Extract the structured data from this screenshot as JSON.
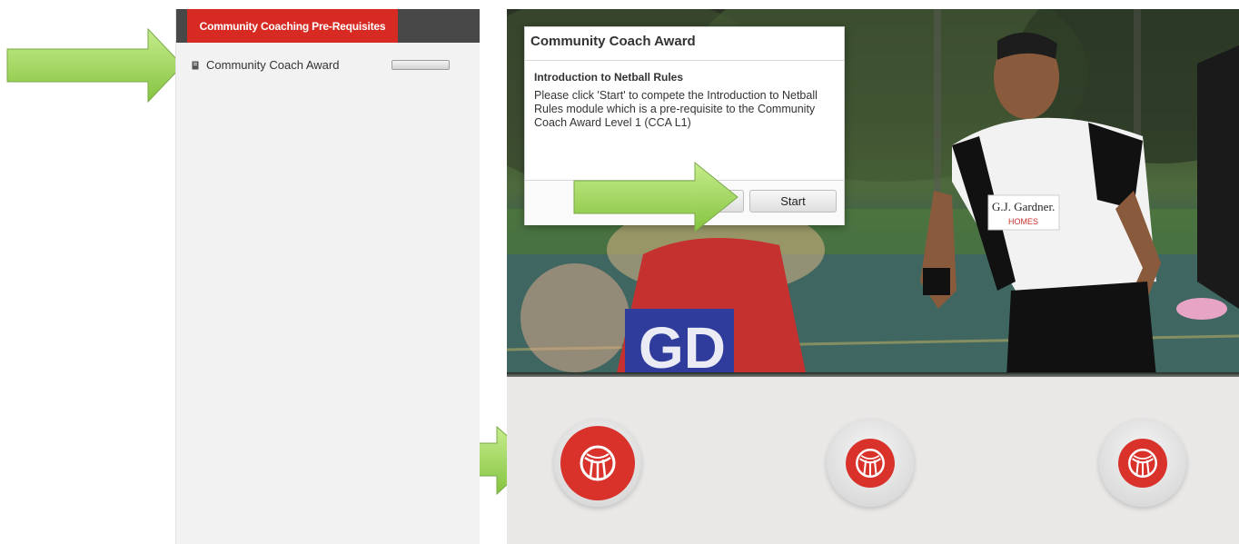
{
  "sidebar": {
    "tab_label": "Community Coaching Pre-Requisites",
    "course": {
      "label": "Community Coach Award",
      "icon": "document-icon",
      "progress": 0
    }
  },
  "modal": {
    "title": "Community Coach Award",
    "subtitle": "Introduction to Netball Rules",
    "body": "Please click 'Start' to compete the Introduction to Netball Rules module which is a pre-requisite to the Community Coach Award Level 1 (CCA L1)",
    "cancel_label": "",
    "start_label": "Start"
  },
  "hero": {
    "jersey_text": "G.J. Gardner.",
    "jersey_subtext": "HOMES",
    "bib_text": "GD"
  },
  "modules": [
    {
      "icon": "netball-icon",
      "state": "active"
    },
    {
      "icon": "netball-icon",
      "state": "inactive"
    },
    {
      "icon": "netball-icon",
      "state": "inactive"
    }
  ],
  "colors": {
    "brand_red": "#d72a22",
    "callout_green": "#8fd14f",
    "sidebar_header": "#484848"
  }
}
